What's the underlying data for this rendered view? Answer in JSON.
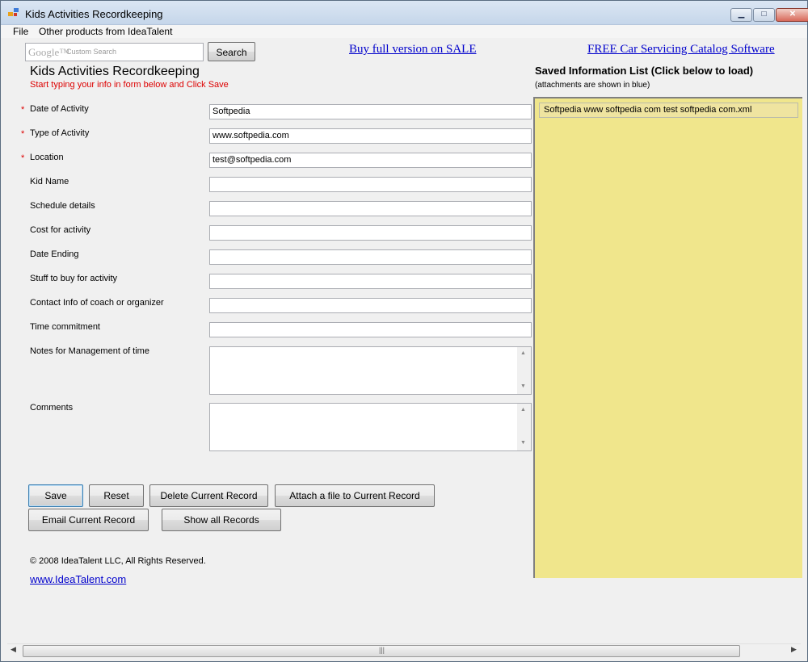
{
  "window": {
    "title": "Kids Activities Recordkeeping",
    "controls": {
      "minimize": "▁",
      "maximize": "□",
      "close": "✕"
    }
  },
  "menu": {
    "items": [
      "File",
      "Other products from IdeaTalent"
    ]
  },
  "search": {
    "brand": "Google™",
    "placeholder": "Custom Search",
    "button_label": "Search"
  },
  "links": {
    "buy": "Buy full version on SALE",
    "car_catalog": "FREE Car Servicing Catalog Software",
    "site": "www.IdeaTalent.com"
  },
  "form": {
    "heading": "Kids Activities Recordkeeping",
    "instruction": "Start typing your info in form below and Click Save",
    "required_marker": "*",
    "fields": [
      {
        "label": "Date of Activity",
        "value": "Softpedia",
        "required": true
      },
      {
        "label": "Type of Activity",
        "value": "www.softpedia.com",
        "required": true
      },
      {
        "label": "Location",
        "value": "test@softpedia.com",
        "required": true
      },
      {
        "label": "Kid Name",
        "value": "",
        "required": false
      },
      {
        "label": "Schedule details",
        "value": "",
        "required": false
      },
      {
        "label": "Cost for activity",
        "value": "",
        "required": false
      },
      {
        "label": "Date Ending",
        "value": "",
        "required": false
      },
      {
        "label": "Stuff to buy for activity",
        "value": "",
        "required": false
      },
      {
        "label": "Contact Info of coach or organizer",
        "value": "",
        "required": false
      },
      {
        "label": "Time commitment",
        "value": "",
        "required": false
      }
    ],
    "notes_label": "Notes for Management of time",
    "comments_label": "Comments"
  },
  "buttons": {
    "save": "Save",
    "reset": "Reset",
    "delete": "Delete Current Record",
    "attach": "Attach a file to Current Record",
    "email": "Email Current Record",
    "show_all": "Show all Records"
  },
  "saved": {
    "heading": "Saved Information List (Click below to load)",
    "note": "(attachments are shown in blue)",
    "items": [
      "Softpedia www softpedia com test softpedia com.xml"
    ]
  },
  "footer": {
    "copyright": "© 2008 IdeaTalent LLC, All Rights Reserved."
  },
  "colors": {
    "accent_required": "#dd0000",
    "saved_list_bg": "#f0e68c",
    "link": "#0000cc"
  },
  "icons": {
    "scroll_up": "▲",
    "scroll_down": "▼",
    "scroll_left": "◀",
    "scroll_right": "▶",
    "grip": "|||"
  }
}
